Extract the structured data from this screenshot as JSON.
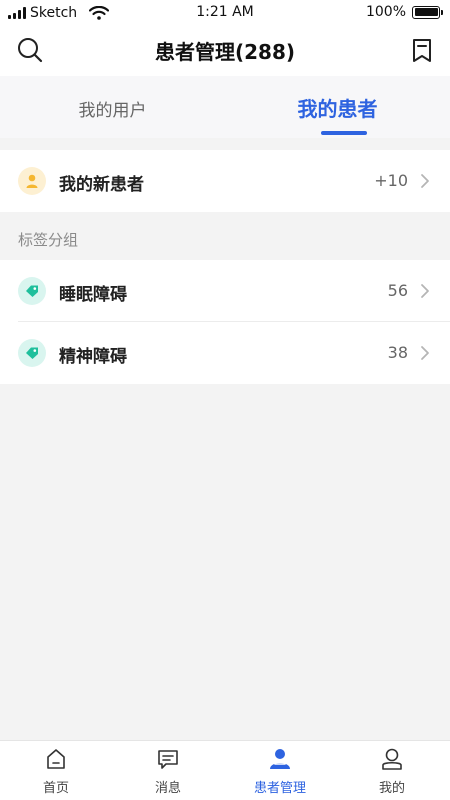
{
  "status_bar": {
    "carrier": "Sketch",
    "time": "1:21 AM",
    "battery": "100%"
  },
  "header": {
    "title": "患者管理(288)",
    "left_icon": "search-icon",
    "right_icon": "bookmark-icon"
  },
  "tabs": [
    {
      "label": "我的用户",
      "active": false
    },
    {
      "label": "我的患者",
      "active": true
    }
  ],
  "new_patients": {
    "label": "我的新患者",
    "count": "+10",
    "icon": "user-icon"
  },
  "tag_section": {
    "label": "标签分组",
    "items": [
      {
        "label": "睡眠障碍",
        "count": "56",
        "icon": "tag-icon"
      },
      {
        "label": "精神障碍",
        "count": "38",
        "icon": "tag-icon"
      }
    ]
  },
  "bottom_nav": [
    {
      "label": "首页",
      "icon": "home-icon",
      "active": false
    },
    {
      "label": "消息",
      "icon": "message-icon",
      "active": false
    },
    {
      "label": "患者管理",
      "icon": "patient-icon",
      "active": true
    },
    {
      "label": "我的",
      "icon": "profile-icon",
      "active": false
    }
  ],
  "colors": {
    "accent": "#2e63e0",
    "tag_icon": "#1fbf9c",
    "user_icon": "#f5b731"
  }
}
